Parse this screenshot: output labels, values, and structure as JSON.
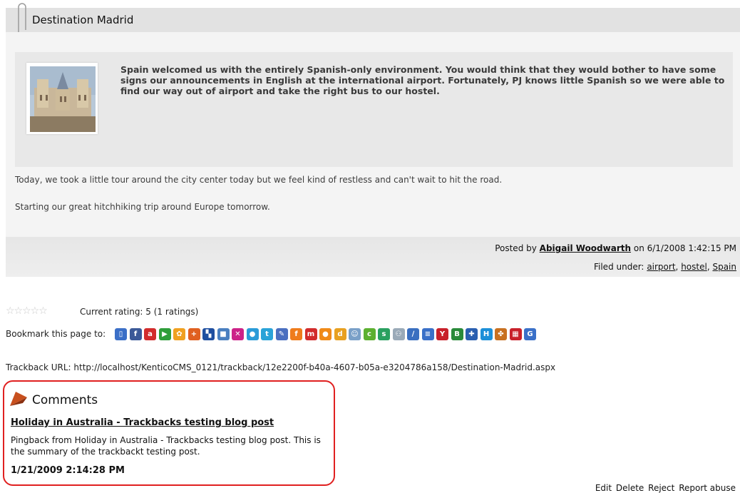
{
  "post": {
    "title": "Destination Madrid",
    "summary": "Spain welcomed us with the entirely Spanish-only environment. You would think that they would bother to have some signs our announcements in English at the international airport. Fortunately, PJ knows little Spanish so we were able to find our way out of airport and take the right bus to our hostel.",
    "paragraphs": [
      "Today, we took a little tour around the city center today but we feel kind of restless and can't wait to hit the road.",
      "Starting our great hitchhiking trip around Europe tomorrow."
    ],
    "posted_by_prefix": "Posted by",
    "author": "Abigail Woodwarth",
    "posted_on": "on 6/1/2008 1:42:15 PM",
    "filed_under_label": "Filed under:",
    "tags": [
      "airport",
      "hostel",
      "Spain"
    ],
    "tag_sep": ","
  },
  "rating": {
    "stars_glyph": "☆☆☆☆☆",
    "value": 5,
    "max": 5,
    "text": "Current rating: 5 (1 ratings)"
  },
  "bookmarks": {
    "label": "Bookmark this page to:",
    "services": [
      {
        "icon": "book-icon",
        "color": "#3b6fc7",
        "glyph": "▯"
      },
      {
        "icon": "facebook-icon",
        "color": "#3b5998",
        "glyph": "f"
      },
      {
        "icon": "ask-icon",
        "color": "#d22c2c",
        "glyph": "a"
      },
      {
        "icon": "arrow-icon",
        "color": "#2f9e3a",
        "glyph": "▶"
      },
      {
        "icon": "flower-icon",
        "color": "#f0a020",
        "glyph": "✿"
      },
      {
        "icon": "plus-icon",
        "color": "#e06020",
        "glyph": "+"
      },
      {
        "icon": "delicious-icon",
        "color": "#1f4fa0",
        "glyph": "▚"
      },
      {
        "icon": "blue-square-icon",
        "color": "#4a7fc0",
        "glyph": "■"
      },
      {
        "icon": "cross-icon",
        "color": "#cc2288",
        "glyph": "✕"
      },
      {
        "icon": "circle-a-icon",
        "color": "#2a9bd8",
        "glyph": "●"
      },
      {
        "icon": "t-icon",
        "color": "#2aa3d8",
        "glyph": "t"
      },
      {
        "icon": "pen-icon",
        "color": "#4a6fc0",
        "glyph": "✎"
      },
      {
        "icon": "orange-f-icon",
        "color": "#ef7c1c",
        "glyph": "f"
      },
      {
        "icon": "m-icon",
        "color": "#d22c2c",
        "glyph": "m"
      },
      {
        "icon": "orange-circle-icon",
        "color": "#f08a18",
        "glyph": "●"
      },
      {
        "icon": "digg-icon",
        "color": "#e8a020",
        "glyph": "d"
      },
      {
        "icon": "reddit-icon",
        "color": "#7aa0c8",
        "glyph": "☺"
      },
      {
        "icon": "green-c-icon",
        "color": "#5cb030",
        "glyph": "c"
      },
      {
        "icon": "stumble-icon",
        "color": "#2aa060",
        "glyph": "s"
      },
      {
        "icon": "people-icon",
        "color": "#9aaab8",
        "glyph": "⚇"
      },
      {
        "icon": "slash-icon",
        "color": "#3a6fc0",
        "glyph": "∕"
      },
      {
        "icon": "list-icon",
        "color": "#3a70c8",
        "glyph": "≡"
      },
      {
        "icon": "yahoo-icon",
        "color": "#c8202a",
        "glyph": "Y"
      },
      {
        "icon": "book-green-icon",
        "color": "#2a8a3a",
        "glyph": "B"
      },
      {
        "icon": "plus-blue-icon",
        "color": "#2a5fb0",
        "glyph": "✚"
      },
      {
        "icon": "h-icon",
        "color": "#1c8fd8",
        "glyph": "H"
      },
      {
        "icon": "animal-icon",
        "color": "#c87020",
        "glyph": "✤"
      },
      {
        "icon": "grid-icon",
        "color": "#c8202a",
        "glyph": "▦"
      },
      {
        "icon": "google-icon",
        "color": "#3a70c8",
        "glyph": "G"
      }
    ]
  },
  "trackback": {
    "text": "Trackback URL: http://localhost/KenticoCMS_0121/trackback/12e2200f-b40a-4607-b05a-e3204786a158/Destination-Madrid.aspx"
  },
  "comments": {
    "heading": "Comments",
    "items": [
      {
        "title": "Holiday in Australia - Trackbacks testing blog post",
        "body": "Pingback from Holiday in Australia - Trackbacks testing blog post. This is the summary of the trackbackt testing post.",
        "date": "1/21/2009 2:14:28 PM"
      }
    ],
    "actions": [
      "Edit",
      "Delete",
      "Reject",
      "Report abuse"
    ]
  }
}
